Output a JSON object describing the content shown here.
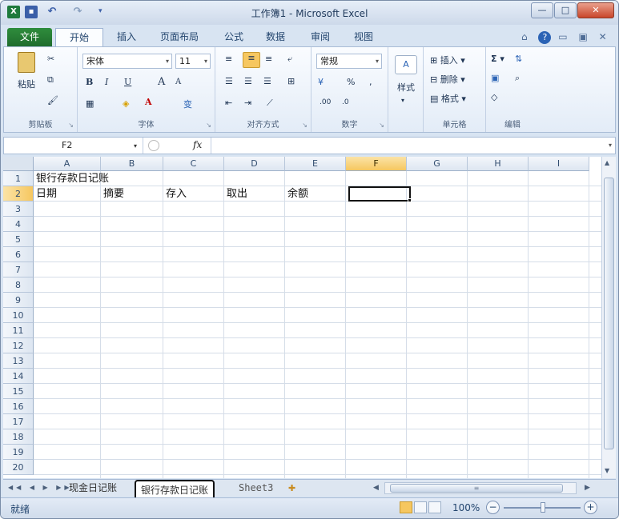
{
  "window": {
    "title": "工作簿1 - Microsoft Excel"
  },
  "title_bar": {
    "app_icon": "X",
    "save_icon": "save-icon",
    "undo_icon": "undo-icon",
    "redo_icon": "redo-icon",
    "minimize": "—",
    "maximize": "□",
    "close": "✕"
  },
  "ribbon_tabs": [
    "文件",
    "开始",
    "插入",
    "页面布局",
    "公式",
    "数据",
    "审阅",
    "视图"
  ],
  "active_tab": "开始",
  "ribbon": {
    "clipboard": {
      "label": "剪贴板",
      "paste": "粘贴"
    },
    "font": {
      "label": "字体",
      "font_name": "宋体",
      "font_size": "11",
      "bold": "B",
      "italic": "I",
      "underline": "U",
      "grow": "A",
      "shrink": "A",
      "wen": "变"
    },
    "alignment": {
      "label": "对齐方式"
    },
    "number": {
      "label": "数字",
      "format": "常规",
      "percent": "%"
    },
    "styles": {
      "label": "样式"
    },
    "cells": {
      "label": "单元格",
      "insert": "插入",
      "delete": "删除",
      "format": "格式"
    },
    "editing": {
      "label": "编辑",
      "sum": "Σ"
    }
  },
  "formula_bar": {
    "name_box": "F2",
    "fx": "fx",
    "value": ""
  },
  "grid": {
    "columns": [
      "A",
      "B",
      "C",
      "D",
      "E",
      "F",
      "G",
      "H",
      "I"
    ],
    "selected_column": "F",
    "rows": [
      "1",
      "2",
      "3",
      "4",
      "5",
      "6",
      "7",
      "8",
      "9",
      "10",
      "11",
      "12",
      "13",
      "14",
      "15",
      "16",
      "17",
      "18",
      "19",
      "20"
    ],
    "selected_row": "2",
    "cells": {
      "A1": "银行存款日记账",
      "A2": "日期",
      "B2": "摘要",
      "C2": "存入",
      "D2": "取出",
      "E2": "余额"
    },
    "active_cell": "F2"
  },
  "sheet_tabs": [
    "现金日记账",
    "银行存款日记账",
    "Sheet3"
  ],
  "active_sheet": "银行存款日记账",
  "status_bar": {
    "status": "就绪",
    "zoom": "100%"
  },
  "colors": {
    "file_tab": "#1e6b2c",
    "selection": "#f6c760",
    "header": "#dde6f1"
  }
}
